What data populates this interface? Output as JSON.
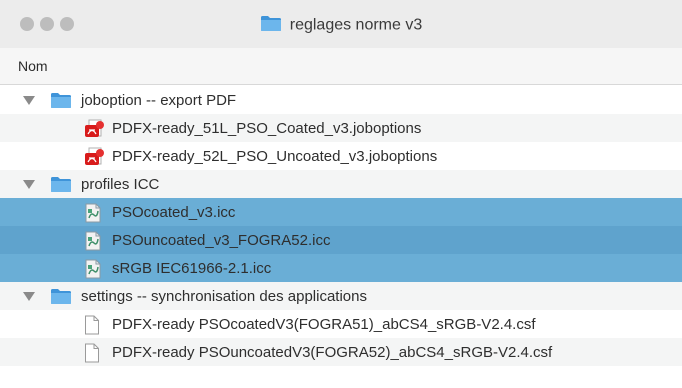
{
  "window": {
    "title": "reglages norme v3"
  },
  "header": {
    "name_column": "Nom"
  },
  "colors": {
    "selection": "#6aaed6",
    "folder": "#5aa7e6"
  },
  "rows": [
    {
      "label": "joboption -- export PDF",
      "kind": "folder",
      "icon": "folder-icon",
      "expanded": true,
      "level": 0
    },
    {
      "label": "PDFX-ready_51L_PSO_Coated_v3.joboptions",
      "kind": "file",
      "icon": "acrobat-joboptions-icon",
      "level": 1
    },
    {
      "label": "PDFX-ready_52L_PSO_Uncoated_v3.joboptions",
      "kind": "file",
      "icon": "acrobat-joboptions-icon",
      "level": 1
    },
    {
      "label": "profiles ICC",
      "kind": "folder",
      "icon": "folder-icon",
      "expanded": true,
      "level": 0
    },
    {
      "label": "PSOcoated_v3.icc",
      "kind": "file",
      "icon": "icc-profile-icon",
      "level": 1,
      "selected": true
    },
    {
      "label": "PSOuncoated_v3_FOGRA52.icc",
      "kind": "file",
      "icon": "icc-profile-icon",
      "level": 1,
      "selected": true
    },
    {
      "label": "sRGB IEC61966-2.1.icc",
      "kind": "file",
      "icon": "icc-profile-icon",
      "level": 1,
      "selected": true
    },
    {
      "label": "settings -- synchronisation des applications",
      "kind": "folder",
      "icon": "folder-icon",
      "expanded": true,
      "level": 0
    },
    {
      "label": "PDFX-ready PSOcoatedV3(FOGRA51)_abCS4_sRGB-V2.4.csf",
      "kind": "file",
      "icon": "document-icon",
      "level": 1
    },
    {
      "label": "PDFX-ready PSOuncoatedV3(FOGRA52)_abCS4_sRGB-V2.4.csf",
      "kind": "file",
      "icon": "document-icon",
      "level": 1
    }
  ]
}
